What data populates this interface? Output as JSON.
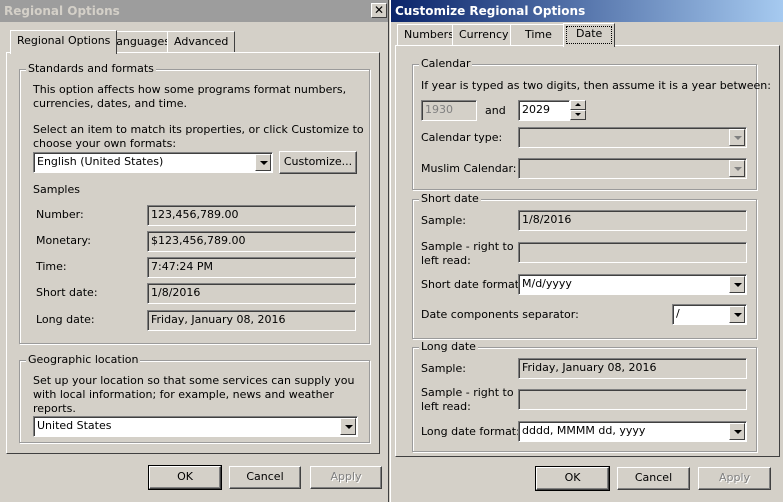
{
  "left": {
    "title": "Regional Options",
    "tabs": [
      "Regional Options",
      "Languages",
      "Advanced"
    ],
    "standards": {
      "legend": "Standards and formats",
      "description": "This option affects how some programs format numbers, currencies, dates, and time.",
      "select_hint": "Select an item to match its properties, or click Customize to choose your own formats:",
      "locale": "English (United States)",
      "customize_label": "Customize...",
      "samples_heading": "Samples",
      "samples": [
        {
          "label": "Number:",
          "value": "123,456,789.00"
        },
        {
          "label": "Monetary:",
          "value": "$123,456,789.00"
        },
        {
          "label": "Time:",
          "value": "7:47:24 PM"
        },
        {
          "label": "Short date:",
          "value": "1/8/2016"
        },
        {
          "label": "Long date:",
          "value": "Friday, January 08, 2016"
        }
      ]
    },
    "geo": {
      "legend": "Geographic location",
      "description": "Set up your location so that some services can supply you with local information; for example, news and weather reports.",
      "location": "United States"
    },
    "buttons": {
      "ok": "OK",
      "cancel": "Cancel",
      "apply": "Apply"
    }
  },
  "right": {
    "title": "Customize Regional Options",
    "tabs": [
      "Numbers",
      "Currency",
      "Time",
      "Date"
    ],
    "calendar": {
      "legend": "Calendar",
      "two_digit_text": "If year is typed as two digits, then assume it is a year between:",
      "year_from": "1930",
      "and_label": "and",
      "year_to": "2029",
      "calendar_type_label": "Calendar type:",
      "calendar_type_value": "",
      "muslim_label": "Muslim Calendar:",
      "muslim_value": ""
    },
    "short_date": {
      "legend": "Short date",
      "sample_label": "Sample:",
      "sample_value": "1/8/2016",
      "rtl_label_1": "Sample - right to",
      "rtl_label_2": "left read:",
      "rtl_value": "",
      "format_label": "Short date format:",
      "format_value": "M/d/yyyy",
      "separator_label": "Date components separator:",
      "separator_value": "/"
    },
    "long_date": {
      "legend": "Long date",
      "sample_label": "Sample:",
      "sample_value": "Friday, January 08, 2016",
      "rtl_label_1": "Sample - right to",
      "rtl_label_2": "left read:",
      "rtl_value": "",
      "format_label": "Long date format:",
      "format_value": "dddd, MMMM dd, yyyy"
    },
    "buttons": {
      "ok": "OK",
      "cancel": "Cancel",
      "apply": "Apply"
    }
  }
}
